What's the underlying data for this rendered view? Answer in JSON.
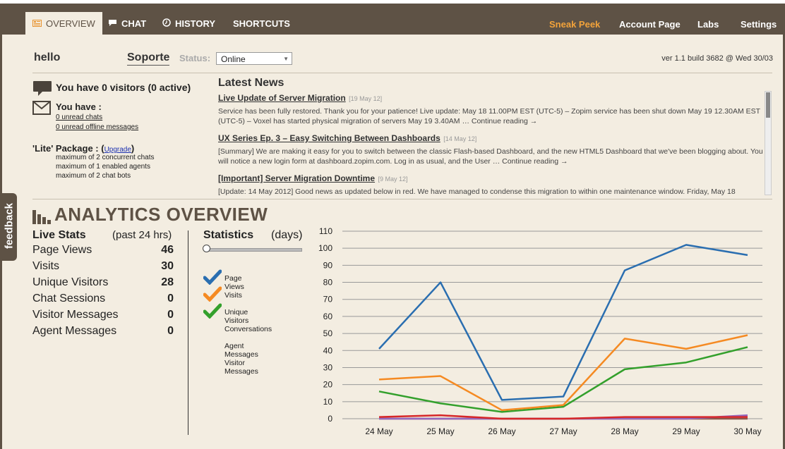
{
  "nav": {
    "tabs": [
      {
        "label": "OVERVIEW",
        "icon": "dashboard-icon",
        "active": true
      },
      {
        "label": "CHAT",
        "icon": "chat-bubble-icon"
      },
      {
        "label": "HISTORY",
        "icon": "clock-icon"
      },
      {
        "label": "SHORTCUTS"
      }
    ],
    "right": [
      {
        "label": "Sneak Peek",
        "color": "#f3a33a"
      },
      {
        "label": "Account Page"
      },
      {
        "label": "Labs"
      },
      {
        "label": "Settings"
      }
    ]
  },
  "header": {
    "greeting": "hello",
    "department": "Soporte",
    "status_label": "Status:",
    "status_value": "Online",
    "version": "ver 1.1 build 3682 @ Wed 30/03"
  },
  "visitors": {
    "text": "You have 0 visitors (0 active)",
    "you_have": "You have :",
    "unread_chats": "0 unread chats",
    "unread_offline": "0 unread offline messages"
  },
  "package": {
    "title": "'Lite' Package :",
    "upgrade": "Upgrade",
    "lines": [
      "maximum of 2 concurrent chats",
      "maximum of 1 enabled agents",
      "maximum of 2 chat bots"
    ]
  },
  "news": {
    "title": "Latest News",
    "items": [
      {
        "headline": "Live Update of Server Migration",
        "date": "[19 May 12]",
        "body": "Service has been fully restored. Thank you for your patience! Live update: May 18 11.00PM EST (UTC-5) – Zopim service has been shut down May 19 12.30AM EST (UTC-5) – Voxel has started physical migration of servers May 19 3.40AM … Continue reading →"
      },
      {
        "headline": "UX Series Ep. 3 – Easy Switching Between Dashboards",
        "date": "[14 May 12]",
        "body": "[Summary] We are making it easy for you to switch between the classic Flash-based Dashboard, and the new HTML5 Dashboard that we've been blogging about. You will notice a new login form at dashboard.zopim.com. Log in as usual, and the User … Continue reading →"
      },
      {
        "headline": "[Important] Server Migration Downtime",
        "date": "[9 May 12]",
        "body": "[Update: 14 May 2012] Good news as updated below in red. We have managed to condense this migration to within one maintenance window. Friday, May 18"
      }
    ]
  },
  "feedback_label": "feedback",
  "analytics": {
    "title": "ANALYTICS OVERVIEW",
    "live_stats_title": "Live Stats",
    "live_stats_sub": "(past 24 hrs)",
    "stats": [
      {
        "label": "Page Views",
        "value": "46"
      },
      {
        "label": "Visits",
        "value": "30"
      },
      {
        "label": "Unique Visitors",
        "value": "28"
      },
      {
        "label": "Chat Sessions",
        "value": "0"
      },
      {
        "label": "Visitor Messages",
        "value": "0"
      },
      {
        "label": "Agent Messages",
        "value": "0"
      }
    ],
    "statistics_title": "Statistics",
    "statistics_sub": "(days)",
    "legend": [
      {
        "label": "Page Views",
        "checked": true,
        "color": "#2a6eb0"
      },
      {
        "label": "Visits",
        "checked": true,
        "color": "#f58a22"
      },
      {
        "label": "Unique Visitors",
        "checked": true,
        "color": "#33a02c"
      },
      {
        "label": "Conversations",
        "checked": false
      },
      {
        "label": "Agent Messages",
        "checked": false
      },
      {
        "label": "Visitor Messages",
        "checked": false
      }
    ]
  },
  "chart_data": {
    "type": "line",
    "x": [
      "24 May",
      "25 May",
      "26 May",
      "27 May",
      "28 May",
      "29 May",
      "30 May"
    ],
    "ylim": [
      0,
      110
    ],
    "yticks": [
      0,
      10,
      20,
      30,
      40,
      50,
      60,
      70,
      80,
      90,
      100,
      110
    ],
    "grid": true,
    "series": [
      {
        "name": "Page Views",
        "color": "#2a6eb0",
        "values": [
          41,
          80,
          11,
          13,
          87,
          102,
          96
        ]
      },
      {
        "name": "Visits",
        "color": "#f58a22",
        "values": [
          23,
          25,
          5,
          8,
          47,
          41,
          49
        ]
      },
      {
        "name": "Unique Visitors",
        "color": "#33a02c",
        "values": [
          16,
          9,
          4,
          7,
          29,
          33,
          42
        ]
      },
      {
        "name": "Conversations",
        "color": "#d62728",
        "values": [
          1,
          2,
          0,
          0,
          1,
          1,
          1
        ]
      },
      {
        "name": "Agent Messages",
        "color": "#9467bd",
        "values": [
          0,
          0,
          0,
          0,
          0,
          0,
          2
        ]
      },
      {
        "name": "Visitor Messages",
        "color": "#8c564b",
        "values": [
          0,
          0,
          0,
          0,
          0,
          0,
          0
        ]
      }
    ]
  }
}
